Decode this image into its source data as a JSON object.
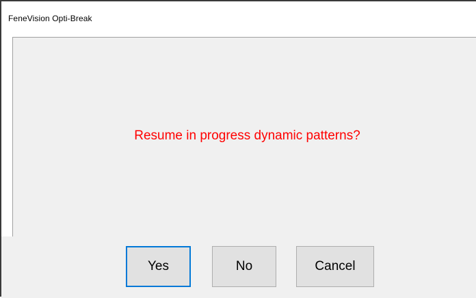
{
  "window": {
    "title": "FeneVision Opti-Break"
  },
  "dialog": {
    "message": "Resume in progress dynamic patterns?",
    "message_color": "#ff0000"
  },
  "buttons": {
    "yes_label": "Yes",
    "no_label": "No",
    "cancel_label": "Cancel",
    "default_button": "Yes",
    "default_accent": "#0078d7"
  }
}
